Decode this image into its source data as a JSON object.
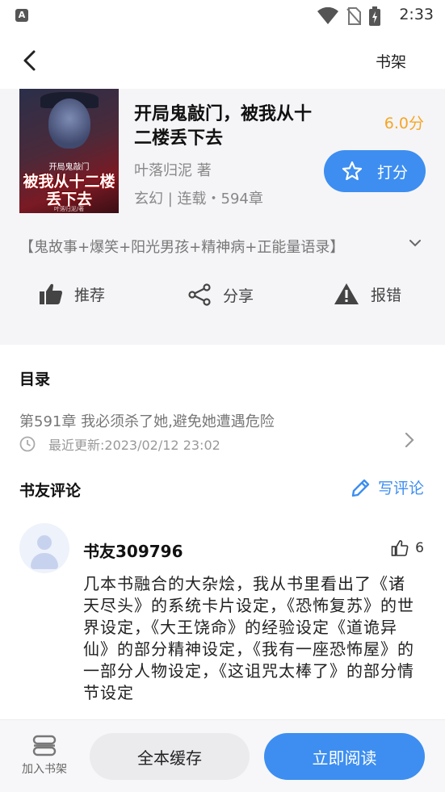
{
  "status_bar": {
    "app_badge": "A",
    "time": "2:33"
  },
  "header": {
    "shelf_label": "书架"
  },
  "book": {
    "title": "开局鬼敲门，被我从十二楼丢下去",
    "score": "6.0分",
    "author": "叶落归泥 著",
    "meta": "玄幻 | 连载・594章",
    "rate_label": "打分",
    "tags": "【鬼故事+爆笑+阳光男孩+精神病+正能量语录】",
    "cover": {
      "small_text": "开局鬼敲门",
      "big_line1": "被我从十二楼",
      "big_line2": "丢下去",
      "tiny_text": "叶落归泥/著"
    }
  },
  "actions": {
    "recommend": "推荐",
    "share": "分享",
    "report": "报错"
  },
  "toc": {
    "title": "目录",
    "latest_chapter": "第591章 我必须杀了她,避免她遭遇危险",
    "last_update": "最近更新:2023/02/12 23:02"
  },
  "reviews": {
    "title": "书友评论",
    "write_label": "写评论",
    "items": [
      {
        "user": "书友309796",
        "likes": "6",
        "text": "几本书融合的大杂烩，我从书里看出了《诸天尽头》的系统卡片设定，《恐怖复苏》的世界设定，《大王饶命》的经验设定《道诡异仙》的部分精神设定，《我有一座恐怖屋》的一部分人物设定，《这诅咒太棒了》的部分情节设定"
      }
    ]
  },
  "bottom_bar": {
    "add_shelf": "加入书架",
    "cache_all": "全本缓存",
    "read_now": "立即阅读"
  },
  "colors": {
    "accent": "#3d8ef0",
    "score": "#f5a623",
    "info_bg": "#f5f5f8"
  }
}
